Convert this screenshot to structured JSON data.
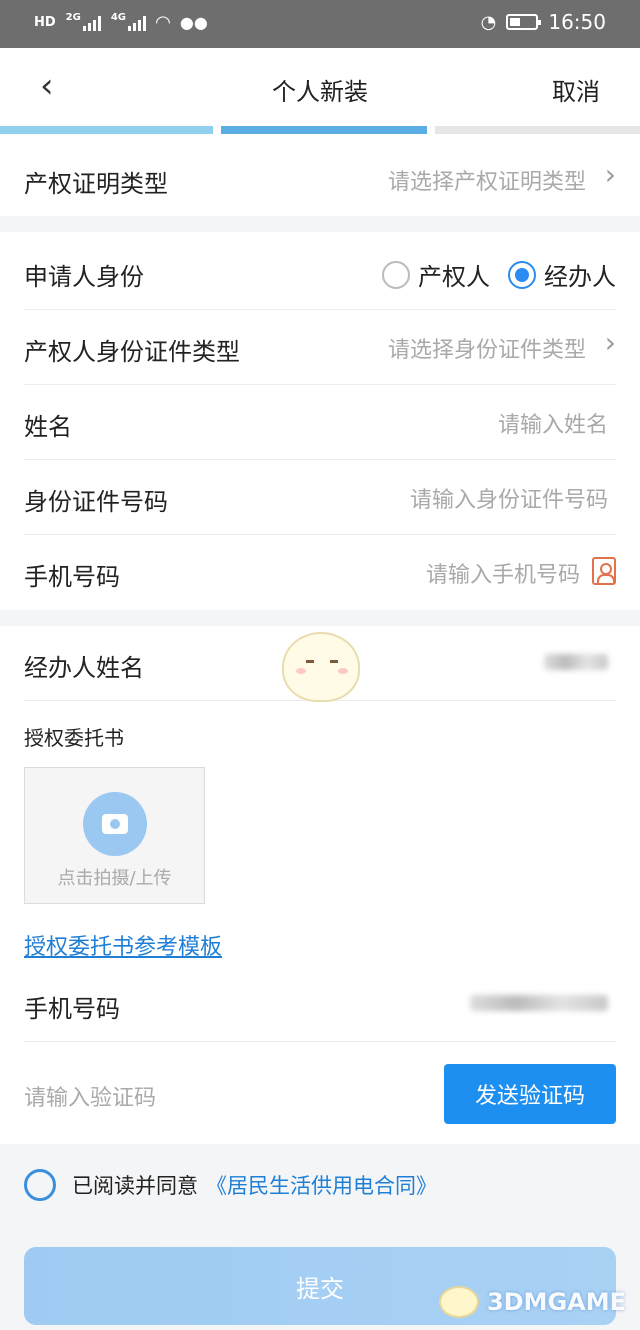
{
  "status_bar": {
    "hd_label": "HD",
    "net1": "2G",
    "net2": "4G",
    "time": "16:50"
  },
  "header": {
    "title": "个人新装",
    "cancel_label": "取消"
  },
  "progress": {
    "total_steps": 3,
    "completed_steps": 2,
    "colors": [
      "#8fd0ec",
      "#5aaee3",
      "#e6e6e6"
    ]
  },
  "property_type": {
    "label": "产权证明类型",
    "placeholder": "请选择产权证明类型"
  },
  "applicant": {
    "identity_label": "申请人身份",
    "options": [
      "产权人",
      "经办人"
    ],
    "selected": "经办人",
    "id_type_label": "产权人身份证件类型",
    "id_type_placeholder": "请选择身份证件类型",
    "name_label": "姓名",
    "name_placeholder": "请输入姓名",
    "id_number_label": "身份证件号码",
    "id_number_placeholder": "请输入身份证件号码",
    "phone_label": "手机号码",
    "phone_placeholder": "请输入手机号码"
  },
  "agent": {
    "name_label": "经办人姓名",
    "authorization_label": "授权委托书",
    "upload_text": "点击拍摄/上传",
    "template_link": "授权委托书参考模板",
    "phone_label": "手机号码",
    "code_placeholder": "请输入验证码",
    "send_code_label": "发送验证码"
  },
  "agreement": {
    "prefix": "已阅读并同意",
    "contract_link": "《居民生活供用电合同》"
  },
  "submit_label": "提交",
  "watermark": "3DMGAME",
  "colors": {
    "accent": "#1d8ff0",
    "link": "#1f7fd6",
    "placeholder": "#a9a9a9",
    "status_bar": "#6e6e6e"
  }
}
